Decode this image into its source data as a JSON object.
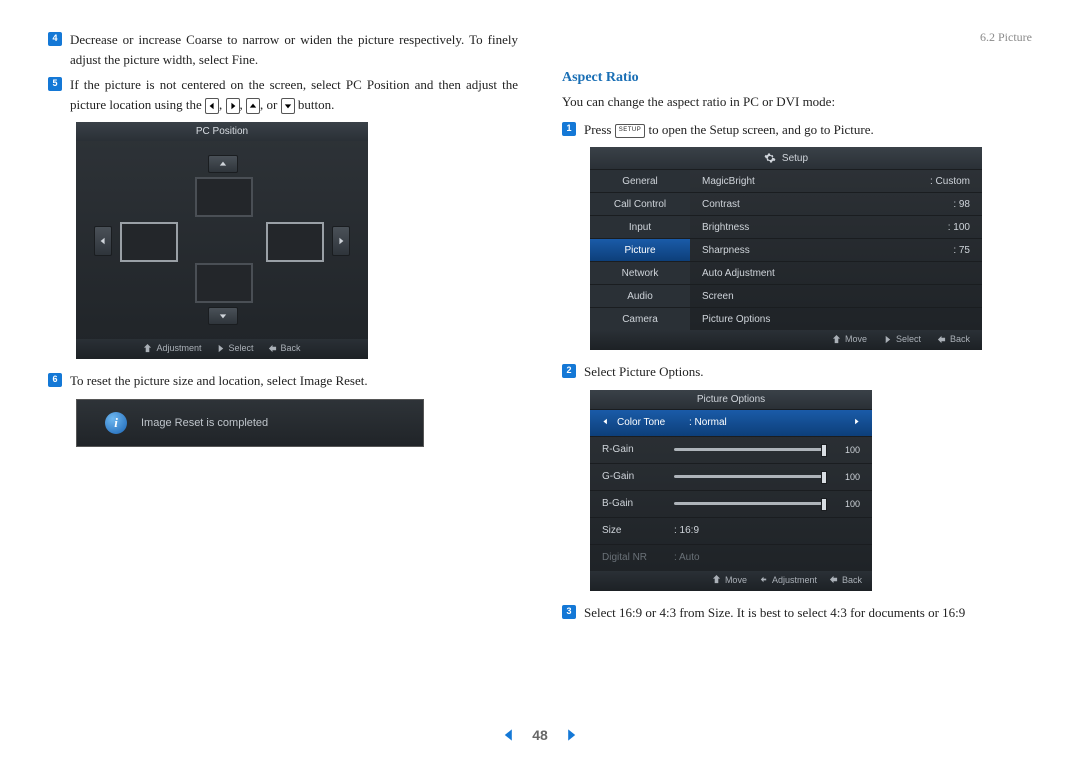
{
  "header": {
    "section": "6.2 Picture"
  },
  "left": {
    "step4": "Decrease or increase Coarse to narrow or widen the picture respectively. To finely adjust the picture width, select Fine.",
    "step5a": "If the picture is not centered on the screen, select PC Position and then adjust the picture location using the ",
    "step5b": " button.",
    "or": ", or ",
    "comma": ", ",
    "step6": "To reset the picture size and location, select Image Reset.",
    "pcpos_title": "PC Position",
    "footer_adjust": "Adjustment",
    "footer_select": "Select",
    "footer_back": "Back",
    "reset_msg": "Image Reset is completed"
  },
  "right": {
    "title": "Aspect Ratio",
    "intro": "You can change the aspect ratio in PC or DVI mode:",
    "step1a": "Press ",
    "setup_key": "SETUP",
    "step1b": " to open the Setup screen, and go to Picture.",
    "step2": "Select Picture Options.",
    "step3": "Select 16:9 or 4:3 from Size. It is best to select 4:3 for documents or 16:9"
  },
  "setup": {
    "title": "Setup",
    "side": [
      "General",
      "Call Control",
      "Input",
      "Picture",
      "Network",
      "Audio",
      "Camera"
    ],
    "main": [
      {
        "label": "MagicBright",
        "value": ": Custom"
      },
      {
        "label": "Contrast",
        "value": ": 98"
      },
      {
        "label": "Brightness",
        "value": ": 100"
      },
      {
        "label": "Sharpness",
        "value": ": 75"
      },
      {
        "label": "Auto Adjustment",
        "value": ""
      },
      {
        "label": "Screen",
        "value": ""
      },
      {
        "label": "Picture Options",
        "value": ""
      }
    ],
    "footer_move": "Move",
    "footer_select": "Select",
    "footer_back": "Back"
  },
  "po": {
    "title": "Picture Options",
    "row_colortone": {
      "label": "Color Tone",
      "value": ": Normal"
    },
    "rows": [
      {
        "label": "R-Gain",
        "value": "100",
        "pct": 100
      },
      {
        "label": "G-Gain",
        "value": "100",
        "pct": 100
      },
      {
        "label": "B-Gain",
        "value": "100",
        "pct": 100
      }
    ],
    "row_size": {
      "label": "Size",
      "value": ": 16:9"
    },
    "row_dnr": {
      "label": "Digital NR",
      "value": ": Auto"
    },
    "footer_move": "Move",
    "footer_adjust": "Adjustment",
    "footer_back": "Back"
  },
  "page_number": "48"
}
